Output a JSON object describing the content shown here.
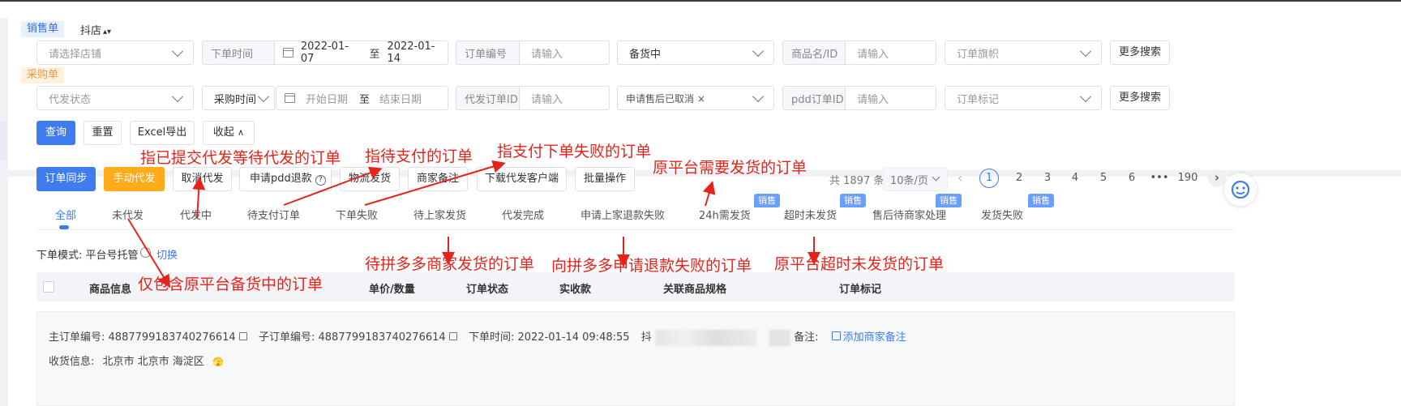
{
  "filters": {
    "sales_tag": "销售单",
    "shop_filter": "抖店",
    "shop_sort_icon": "sort-icon",
    "purchase_tag": "采购单",
    "row1": {
      "store_placeholder": "请选择店铺",
      "order_time_label": "下单时间",
      "date_start": "2022-01-07",
      "date_sep": "至",
      "date_end": "2022-01-14",
      "order_no_label": "订单编号",
      "order_no_placeholder": "请输入",
      "status_value": "备货中",
      "product_label": "商品名/ID",
      "product_placeholder": "请输入",
      "flag_placeholder": "订单旗帜",
      "more_search": "更多搜索"
    },
    "row2": {
      "dropship_status_placeholder": "代发状态",
      "purchase_time_label": "采购时间",
      "start_date_placeholder": "开始日期",
      "date_sep": "至",
      "end_date_placeholder": "结束日期",
      "dropship_order_label": "代发订单ID",
      "dropship_order_placeholder": "请输入",
      "cancel_tag": "申请售后已取消",
      "cancel_tag_close": "×",
      "pdd_order_label": "pdd订单ID",
      "pdd_order_placeholder": "请输入",
      "order_mark_placeholder": "订单标记",
      "more_search": "更多搜索"
    },
    "actions": {
      "query": "查询",
      "reset": "重置",
      "excel_export": "Excel导出",
      "collapse": "收起"
    }
  },
  "toolbar": {
    "sync": "订单同步",
    "manual_dropship": "手动代发",
    "cancel_dropship": "取消代发",
    "pdd_refund": "申请pdd退款",
    "logistics": "物流发货",
    "merchant_note": "商家备注",
    "download_client": "下载代发客户端",
    "batch": "批量操作"
  },
  "pagination": {
    "total": "共 1897 条",
    "page_size": "10条/页",
    "pages": [
      "1",
      "2",
      "3",
      "4",
      "5",
      "6",
      "•••",
      "190"
    ],
    "current": "1"
  },
  "tabs": [
    {
      "label": "全部",
      "active": true
    },
    {
      "label": "未代发"
    },
    {
      "label": "代发中"
    },
    {
      "label": "待支付订单"
    },
    {
      "label": "下单失败"
    },
    {
      "label": "待上家发货"
    },
    {
      "label": "代发完成"
    },
    {
      "label": "申请上家退款失败"
    },
    {
      "label": "24h需发货",
      "badge": "销售"
    },
    {
      "label": "超时未发货",
      "badge": "销售"
    },
    {
      "label": "售后待商家处理",
      "badge": "销售"
    },
    {
      "label": "发货失败",
      "badge": "销售"
    }
  ],
  "mode": {
    "label": "下单模式: 平台号托管",
    "switch": "切换"
  },
  "table_headers": [
    "商品信息",
    "单价/数量",
    "订单状态",
    "实收款",
    "关联商品规格",
    "订单标记"
  ],
  "order": {
    "main_no_label": "主订单编号:",
    "main_no": "4887799183740276614",
    "sub_no_label": "子订单编号:",
    "sub_no": "4887799183740276614",
    "time_label": "下单时间:",
    "time": "2022-01-14 09:48:55",
    "shop_prefix": "抖",
    "note_label": "备注:",
    "add_note": "添加商家备注",
    "address_label": "收货信息:",
    "address": "北京市 北京市 海淀区"
  },
  "annotations": {
    "submitted": "指已提交代发等待代发的订单",
    "pending_payment": "指待支付的订单",
    "pay_failed": "指支付下单失败的订单",
    "need_ship": "原平台需要发货的订单",
    "wait_pdd_ship": "待拼多多商家发货的订单",
    "pdd_refund_fail": "向拼多多申请退款失败的订单",
    "timeout": "原平台超时未发货的订单",
    "stocking_only": "仅包含原平台备货中的订单"
  },
  "colors": {
    "primary": "#3f7cf0",
    "warning": "#ffab1a",
    "annotation": "#e5231b",
    "badge": "#69a0ff"
  }
}
